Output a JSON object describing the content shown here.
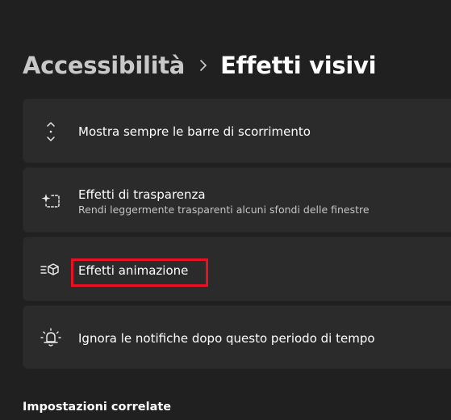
{
  "breadcrumb": {
    "parent": "Accessibilità",
    "current": "Effetti visivi",
    "separator_icon": "chevron-right-icon"
  },
  "settings": [
    {
      "icon": "scrollbar-arrows-icon",
      "title": "Mostra sempre le barre di scorrimento"
    },
    {
      "icon": "transparency-sparkle-icon",
      "title": "Effetti di trasparenza",
      "subtitle": "Rendi leggermente trasparenti alcuni sfondi delle finestre"
    },
    {
      "icon": "animation-effects-icon",
      "title": "Effetti animazione"
    },
    {
      "icon": "notification-bell-icon",
      "title": "Ignora le notifiche dopo questo periodo di tempo"
    }
  ],
  "related": {
    "heading": "Impostazioni correlate"
  },
  "colors": {
    "background": "#202020",
    "card": "#2b2b2b",
    "highlight": "#e81123"
  }
}
